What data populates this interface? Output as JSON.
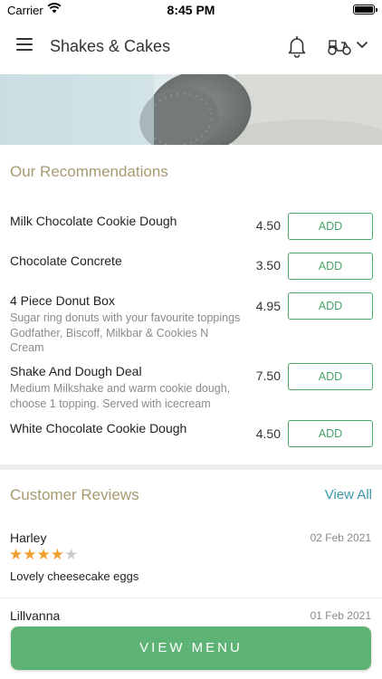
{
  "status_bar": {
    "carrier": "Carrier",
    "time": "8:45 PM"
  },
  "header": {
    "title": "Shakes & Cakes"
  },
  "recommendations": {
    "title": "Our Recommendations",
    "add_label": "ADD",
    "items": [
      {
        "name": "Milk Chocolate Cookie Dough",
        "desc": "",
        "price": "4.50"
      },
      {
        "name": "Chocolate Concrete",
        "desc": "",
        "price": "3.50"
      },
      {
        "name": "4 Piece Donut Box",
        "desc": "Sugar ring donuts with your favourite toppings Godfather, Biscoff,  Milkbar & Cookies N Cream",
        "price": "4.95"
      },
      {
        "name": "Shake And Dough Deal",
        "desc": "Medium Milkshake and warm cookie dough, choose 1 topping. Served with icecream",
        "price": "7.50"
      },
      {
        "name": "White Chocolate Cookie Dough",
        "desc": "",
        "price": "4.50"
      }
    ]
  },
  "reviews": {
    "title": "Customer Reviews",
    "view_all": "View All",
    "items": [
      {
        "name": "Harley",
        "date": "02 Feb 2021",
        "rating": 4,
        "max_rating": 5,
        "text": "Lovely cheesecake eggs"
      },
      {
        "name": "Lillvanna",
        "date": "01 Feb 2021",
        "rating": null,
        "max_rating": 5,
        "text": ""
      }
    ]
  },
  "footer": {
    "view_menu": "VIEW MENU"
  },
  "colors": {
    "accent_green": "#5db374",
    "section_title": "#a89a6f",
    "link_teal": "#3a9aaa",
    "star_on": "#f0a030"
  }
}
